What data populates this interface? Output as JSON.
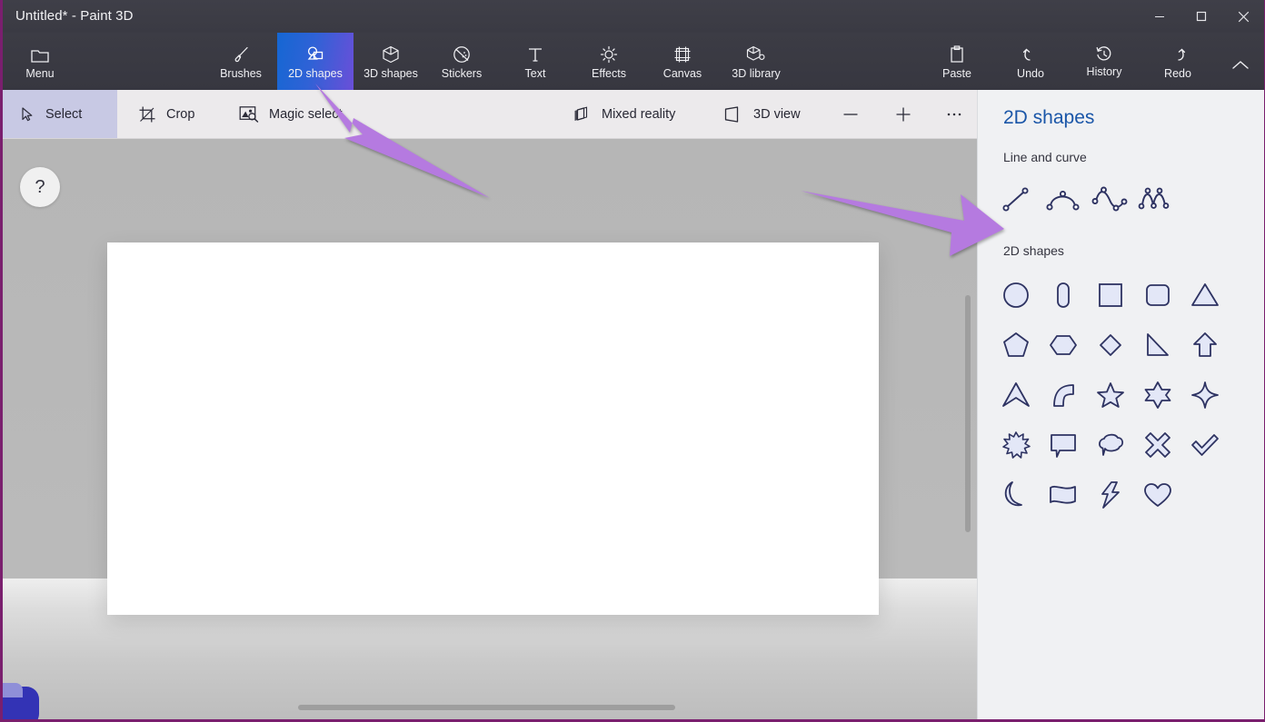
{
  "window": {
    "title": "Untitled* - Paint 3D",
    "controls": [
      {
        "name": "minimize",
        "glyph": "minimize-icon"
      },
      {
        "name": "maximize",
        "glyph": "maximize-icon"
      },
      {
        "name": "close",
        "glyph": "close-icon"
      }
    ],
    "border_color": "#7a1f6e"
  },
  "ribbon": {
    "menu_label": "Menu",
    "tabs": [
      {
        "label": "Brushes",
        "icon": "brush-icon",
        "active": false
      },
      {
        "label": "2D shapes",
        "icon": "2d-shapes-icon",
        "active": true
      },
      {
        "label": "3D shapes",
        "icon": "3d-shapes-icon",
        "active": false
      },
      {
        "label": "Stickers",
        "icon": "stickers-icon",
        "active": false
      },
      {
        "label": "Text",
        "icon": "text-icon",
        "active": false
      },
      {
        "label": "Effects",
        "icon": "effects-icon",
        "active": false
      },
      {
        "label": "Canvas",
        "icon": "canvas-icon",
        "active": false
      },
      {
        "label": "3D library",
        "icon": "3d-library-icon",
        "active": false
      }
    ],
    "right_actions": [
      {
        "label": "Paste",
        "icon": "clipboard-icon"
      },
      {
        "label": "Undo",
        "icon": "undo-icon"
      },
      {
        "label": "History",
        "icon": "history-icon"
      },
      {
        "label": "Redo",
        "icon": "redo-icon"
      }
    ],
    "collapse_label": "",
    "active_tab_gradient": [
      "#1567d3",
      "#6a4fd8"
    ]
  },
  "commandbar": {
    "items": [
      {
        "label": "Select",
        "icon": "cursor-icon",
        "selected": true
      },
      {
        "label": "Crop",
        "icon": "crop-icon",
        "selected": false
      },
      {
        "label": "Magic select",
        "icon": "magic-select-icon",
        "selected": false
      },
      {
        "label": "Mixed reality",
        "icon": "mixed-reality-icon",
        "selected": false
      },
      {
        "label": "3D view",
        "icon": "3d-view-icon",
        "selected": false
      }
    ],
    "zoom_out": "−",
    "zoom_in": "+",
    "more": "…"
  },
  "stage": {
    "help_label": "?",
    "canvas_color": "#ffffff"
  },
  "panel": {
    "title": "2D shapes",
    "sections": [
      {
        "label": "Line and curve",
        "items": [
          {
            "name": "line-shape"
          },
          {
            "name": "curve-one-bend-shape"
          },
          {
            "name": "curve-two-bend-shape"
          },
          {
            "name": "curve-three-bend-shape"
          }
        ]
      },
      {
        "label": "2D shapes",
        "items": [
          {
            "name": "circle-shape"
          },
          {
            "name": "oval-shape"
          },
          {
            "name": "square-shape"
          },
          {
            "name": "rounded-square-shape"
          },
          {
            "name": "triangle-shape"
          },
          {
            "name": "pentagon-shape"
          },
          {
            "name": "hexagon-shape"
          },
          {
            "name": "diamond-shape"
          },
          {
            "name": "right-triangle-shape"
          },
          {
            "name": "arrow-up-shape"
          },
          {
            "name": "chevron-up-shape"
          },
          {
            "name": "quarter-pie-shape"
          },
          {
            "name": "five-point-star-shape"
          },
          {
            "name": "six-point-star-shape"
          },
          {
            "name": "four-point-star-shape"
          },
          {
            "name": "starburst-shape"
          },
          {
            "name": "speech-bubble-shape"
          },
          {
            "name": "thought-bubble-shape"
          },
          {
            "name": "cross-x-shape"
          },
          {
            "name": "checkmark-shape"
          },
          {
            "name": "moon-shape"
          },
          {
            "name": "banner-shape"
          },
          {
            "name": "lightning-bolt-shape"
          },
          {
            "name": "heart-shape"
          }
        ],
        "fill_color": "#e3e7f7",
        "stroke_color": "#2e3362"
      }
    ]
  },
  "annotations": {
    "color": "#b57ae0",
    "arrows": [
      {
        "name": "arrow-to-2d-shapes-tab",
        "points_to": "2D shapes"
      },
      {
        "name": "arrow-to-shapes-panel",
        "points_to": "2D shapes panel"
      }
    ]
  }
}
